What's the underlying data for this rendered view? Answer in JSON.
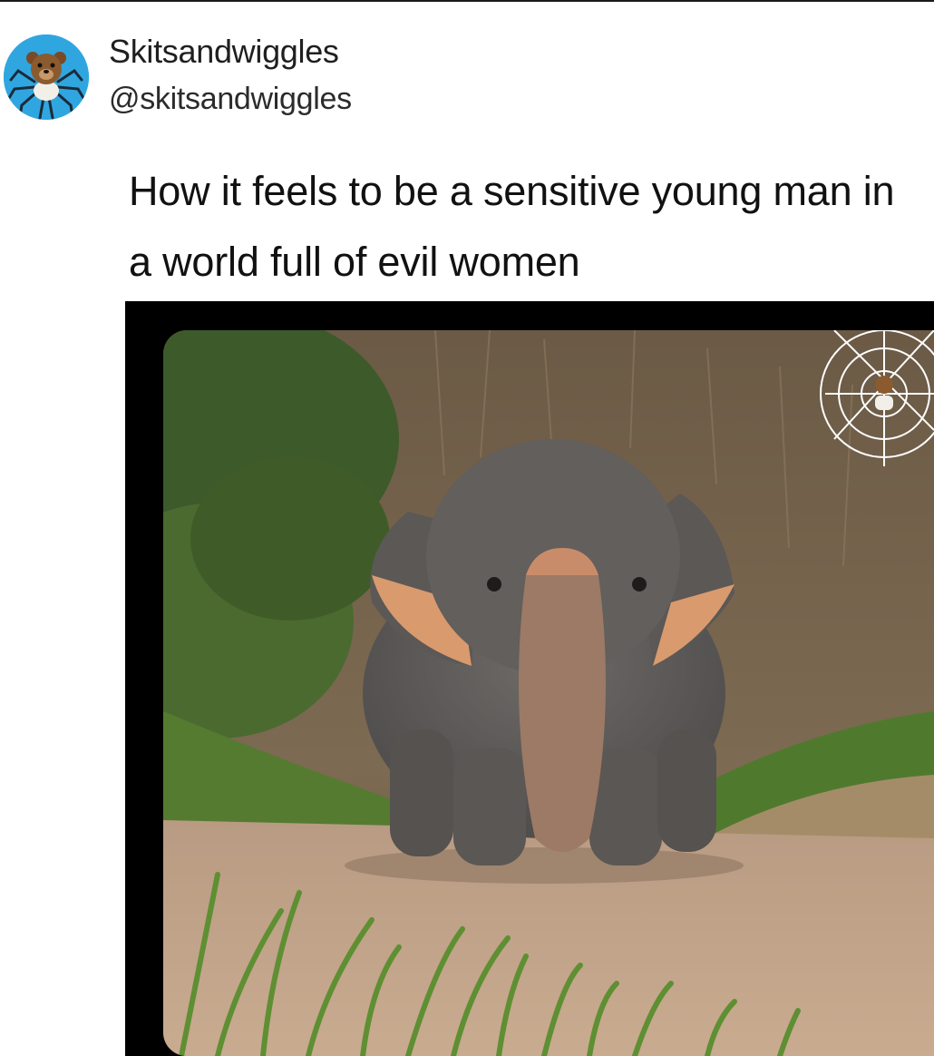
{
  "author": {
    "display_name": "Skitsandwiggles",
    "handle": "@skitsandwiggles",
    "avatar_icon": "bear-spider-emoji-avatar",
    "avatar_bg": "#2fa6e0"
  },
  "tweet": {
    "text": "How it feels to be a sensitive young man in a world full of evil women"
  },
  "media": {
    "description_icon": "elephant-photo",
    "overlay_icon": "bear-spider-web-doodle"
  }
}
